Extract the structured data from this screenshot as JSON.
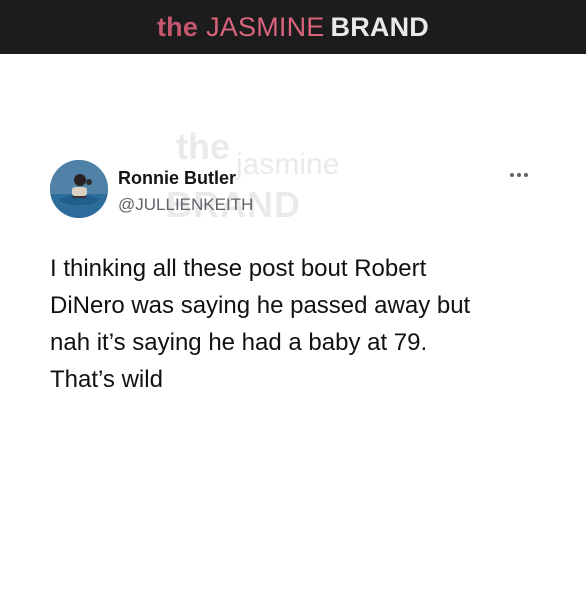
{
  "banner": {
    "the": "the",
    "jasmine": "JASMINE",
    "brand": "BRAND"
  },
  "watermark": {
    "line1": "the",
    "line2": "jasmine",
    "line3": "BRAND"
  },
  "tweet": {
    "author_name": "Ronnie Butler",
    "author_handle": "@JULLIENKEITH",
    "more_icon": "more-options-icon",
    "text": "I thinking all these post bout Robert\nDiNero was saying he passed away but\nnah it’s saying he had a baby at 79.\nThat’s wild"
  }
}
